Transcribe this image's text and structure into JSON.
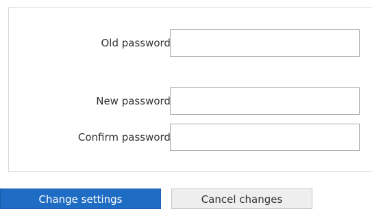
{
  "form": {
    "old_password": {
      "label": "Old password:",
      "value": "",
      "placeholder": ""
    },
    "new_password": {
      "label": "New password:",
      "value": "",
      "placeholder": ""
    },
    "confirm_password": {
      "label": "Confirm password:",
      "value": "",
      "placeholder": ""
    }
  },
  "actions": {
    "change_label": "Change settings",
    "cancel_label": "Cancel changes"
  },
  "colors": {
    "primary_button": "#1f6cc4",
    "secondary_button": "#eeeeee",
    "panel_border": "#d8d8d8",
    "input_border": "#a6a6a6"
  }
}
